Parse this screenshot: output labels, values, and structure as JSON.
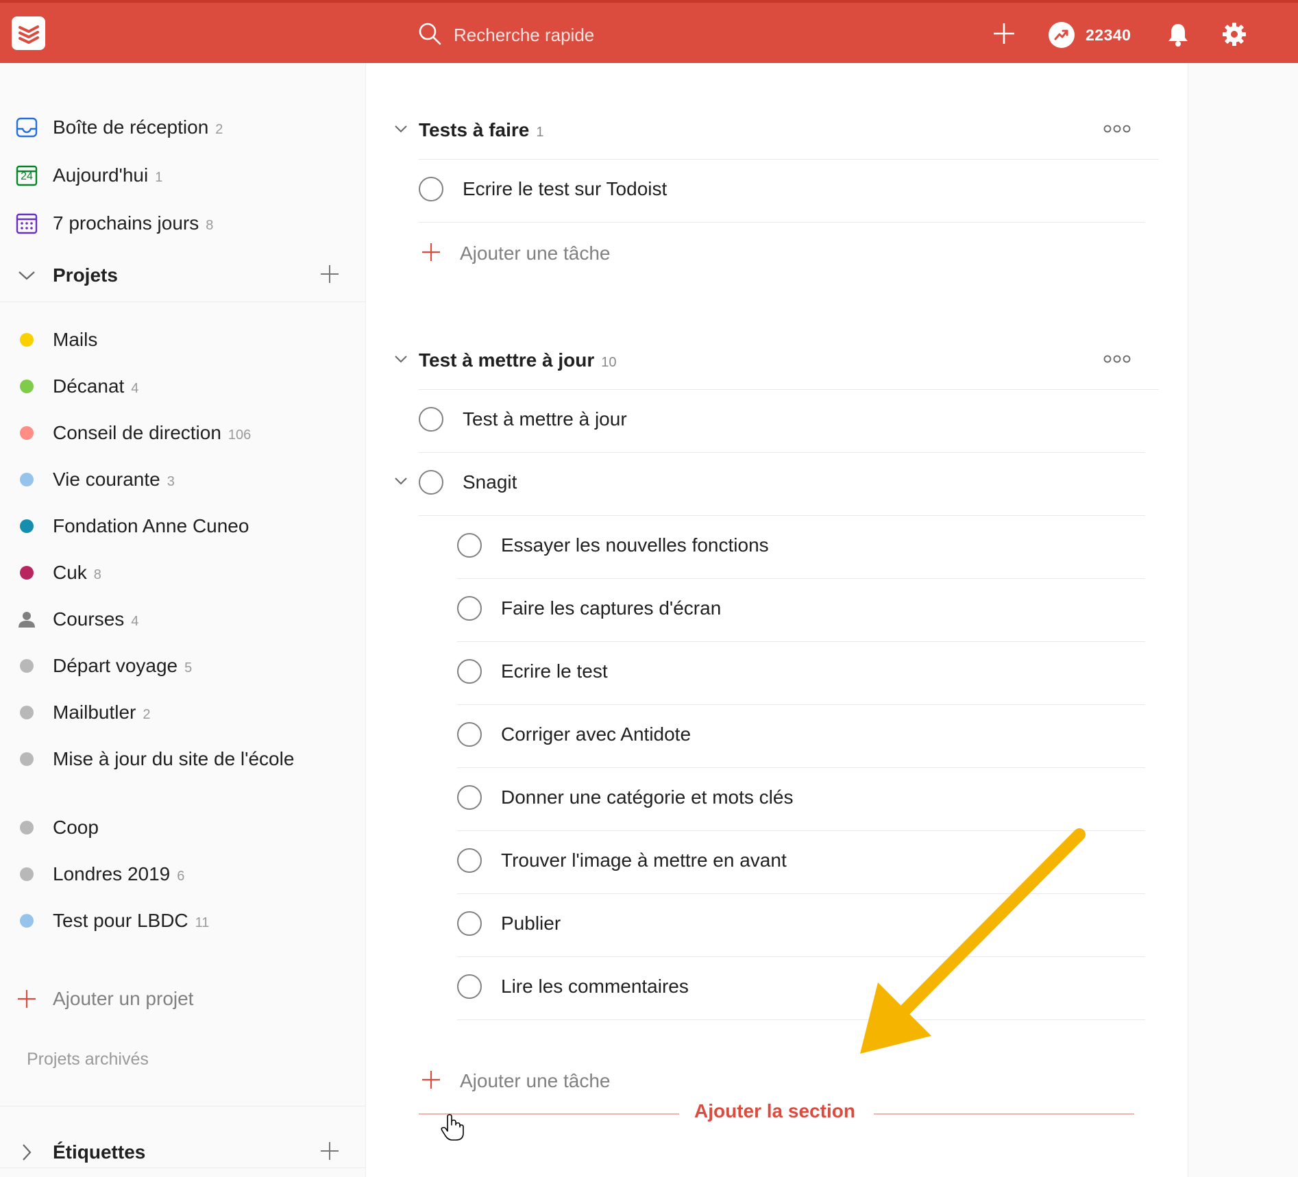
{
  "header": {
    "search_placeholder": "Recherche rapide",
    "karma": "22340",
    "accent_color": "#db4c3f"
  },
  "sidebar": {
    "filters": [
      {
        "label": "Boîte de réception",
        "count": "2",
        "icon": "inbox-icon"
      },
      {
        "label": "Aujourd'hui",
        "count": "1",
        "icon": "calendar-today-icon",
        "icon_text": "24"
      },
      {
        "label": "7 prochains jours",
        "count": "8",
        "icon": "calendar-week-icon"
      }
    ],
    "projects_header": "Projets",
    "projects": [
      {
        "label": "Mails",
        "count": "",
        "color": "#fad000"
      },
      {
        "label": "Décanat",
        "count": "4",
        "color": "#7ecc49"
      },
      {
        "label": "Conseil de direction",
        "count": "106",
        "color": "#ff8d85"
      },
      {
        "label": "Vie courante",
        "count": "3",
        "color": "#96c3eb"
      },
      {
        "label": "Fondation Anne Cuneo",
        "count": "",
        "color": "#158fad"
      },
      {
        "label": "Cuk",
        "count": "8",
        "color": "#b8255f"
      },
      {
        "label": "Courses",
        "count": "4",
        "color": "#808080",
        "icon": "person-icon"
      },
      {
        "label": "Départ voyage",
        "count": "5",
        "color": "#b8b8b8"
      },
      {
        "label": "Mailbutler",
        "count": "2",
        "color": "#b8b8b8"
      },
      {
        "label": "Mise à jour du site de l'école",
        "count": "",
        "color": "#b8b8b8"
      },
      {
        "label": "Coop",
        "count": "",
        "color": "#b8b8b8"
      },
      {
        "label": "Londres 2019",
        "count": "6",
        "color": "#b8b8b8"
      },
      {
        "label": "Test pour LBDC",
        "count": "11",
        "color": "#96c3eb"
      }
    ],
    "add_project": "Ajouter un projet",
    "archived": "Projets archivés",
    "labels_header": "Étiquettes"
  },
  "main": {
    "sections": [
      {
        "title": "Tests à faire",
        "count": "1",
        "tasks": [
          "Ecrire le test sur Todoist"
        ],
        "add_task": "Ajouter une tâche"
      },
      {
        "title": "Test à mettre à jour",
        "count": "10",
        "tasks": [
          "Test à mettre à jour",
          "Snagit"
        ],
        "subtasks": [
          "Essayer les nouvelles fonctions",
          "Faire les captures d'écran",
          "Ecrire le test",
          "Corriger avec Antidote",
          "Donner une catégorie et mots clés",
          "Trouver l'image à mettre en avant",
          "Publier",
          "Lire les commentaires"
        ],
        "add_task": "Ajouter une tâche"
      }
    ],
    "add_section": "Ajouter la section",
    "annotation_arrow_color": "#f5b400"
  }
}
